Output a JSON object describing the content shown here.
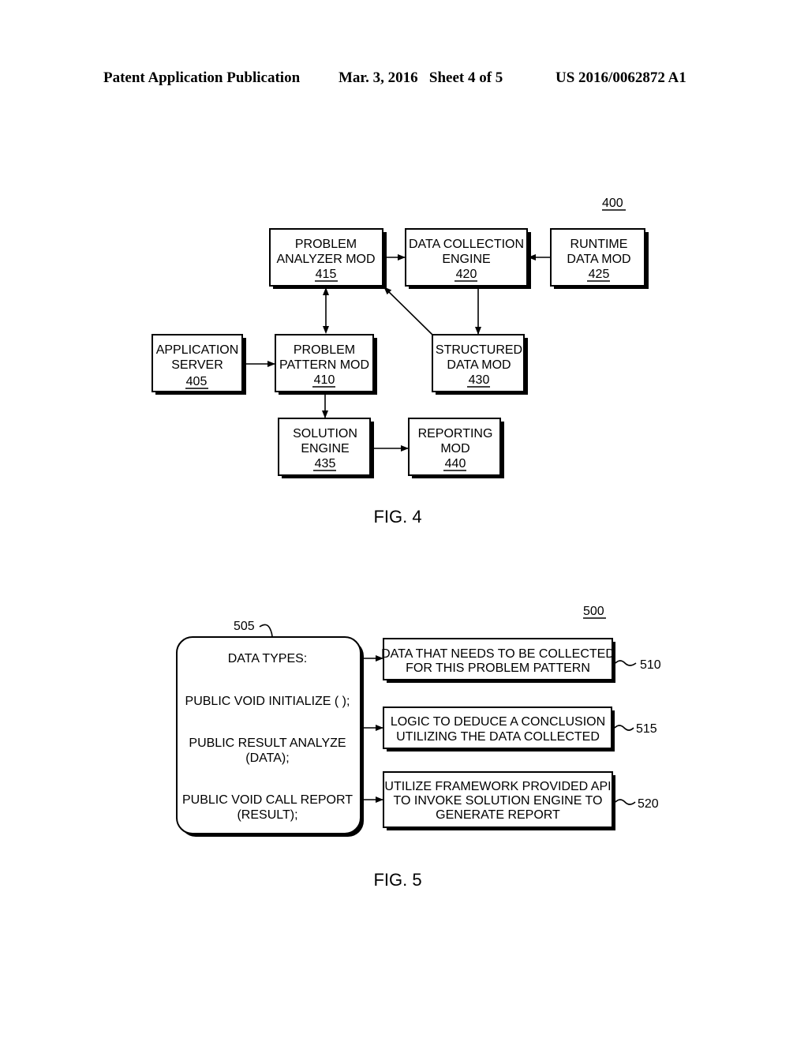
{
  "header": {
    "publication": "Patent Application Publication",
    "date_sheet": "Mar. 3, 2016   Sheet 4 of 5",
    "number": "US 2016/0062872 A1"
  },
  "fig4": {
    "ref": "400",
    "caption": "FIG. 4",
    "boxes": {
      "b415": {
        "l1": "PROBLEM",
        "l2": "ANALYZER MOD",
        "num": "415"
      },
      "b420": {
        "l1": "DATA COLLECTION",
        "l2": "ENGINE",
        "num": "420"
      },
      "b425": {
        "l1": "RUNTIME",
        "l2": "DATA MOD",
        "num": "425"
      },
      "b405": {
        "l1": "APPLICATION",
        "l2": "SERVER",
        "num": "405"
      },
      "b410": {
        "l1": "PROBLEM",
        "l2": "PATTERN MOD",
        "num": "410"
      },
      "b430": {
        "l1": "STRUCTURED",
        "l2": "DATA MOD",
        "num": "430"
      },
      "b435": {
        "l1": "SOLUTION",
        "l2": "ENGINE",
        "num": "435"
      },
      "b440": {
        "l1": "REPORTING",
        "l2": "MOD",
        "num": "440"
      }
    }
  },
  "fig5": {
    "ref": "500",
    "caption": "FIG. 5",
    "left_box": {
      "ref": "505",
      "lines": [
        "DATA TYPES:",
        "PUBLIC VOID INITIALIZE ( );",
        "PUBLIC RESULT ANALYZE",
        "(DATA);",
        "PUBLIC VOID CALL REPORT",
        "(RESULT);"
      ]
    },
    "right_boxes": [
      {
        "ref": "510",
        "l1": "DATA THAT NEEDS TO BE COLLECTED",
        "l2": "FOR THIS PROBLEM PATTERN"
      },
      {
        "ref": "515",
        "l1": "LOGIC TO DEDUCE A CONCLUSION",
        "l2": "UTILIZING THE DATA COLLECTED"
      },
      {
        "ref": "520",
        "l1": "UTILIZE FRAMEWORK PROVIDED API",
        "l2": "TO INVOKE SOLUTION ENGINE TO",
        "l3": "GENERATE REPORT"
      }
    ]
  }
}
